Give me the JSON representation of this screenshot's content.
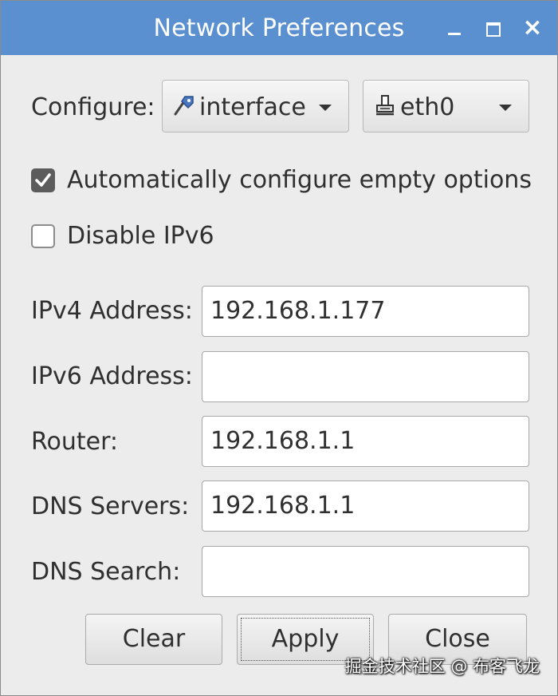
{
  "window": {
    "title": "Network Preferences",
    "controls": {
      "minimize": "minimize",
      "maximize": "maximize",
      "close": "×"
    }
  },
  "configure": {
    "label": "Configure:",
    "type_select": {
      "value": "interface",
      "icon": "wired-plug-icon"
    },
    "device_select": {
      "value": "eth0",
      "icon": "ethernet-port-icon"
    }
  },
  "options": {
    "auto_configure": {
      "label": "Automatically configure empty options",
      "checked": true
    },
    "disable_ipv6": {
      "label": "Disable IPv6",
      "checked": false
    }
  },
  "fields": [
    {
      "label": "IPv4 Address:",
      "value": "192.168.1.177"
    },
    {
      "label": "IPv6 Address:",
      "value": ""
    },
    {
      "label": "Router:",
      "value": "192.168.1.1"
    },
    {
      "label": "DNS Servers:",
      "value": "192.168.1.1"
    },
    {
      "label": "DNS Search:",
      "value": ""
    }
  ],
  "buttons": {
    "clear": "Clear",
    "apply": "Apply",
    "close": "Close"
  },
  "watermark": "掘金技术社区 @ 布客飞龙",
  "colors": {
    "titlebar": "#5a8fd0",
    "window_bg": "#ececec"
  }
}
